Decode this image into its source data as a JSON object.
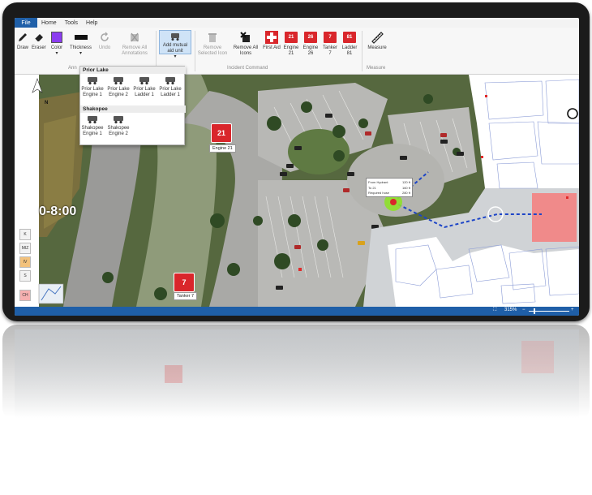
{
  "menu": {
    "file": "File",
    "items": [
      "Home",
      "Tools",
      "Help"
    ]
  },
  "ribbon": {
    "draw": "Draw",
    "eraser": "Eraser",
    "color": "Color",
    "thickness": "Thickness",
    "undo": "Undo",
    "remove_all_annotations": "Remove All Annotations",
    "add_mutual_aid_unit": "Add mutual aid unit",
    "remove_selected_icon": "Remove Selected Icon",
    "remove_all_icons": "Remove All Icons",
    "first_aid": "First Aid",
    "engine21": "Engine 21",
    "engine26": "Engine 26",
    "tanker7": "Tanker 7",
    "ladder81": "Ladder 81",
    "measure": "Measure",
    "group_annotations": "Ann",
    "group_incident_command": "Incident Command",
    "group_measure": "Measure",
    "color_value": "#8b3df0"
  },
  "dropdown": {
    "groups": [
      {
        "name": "Prior Lake",
        "items": [
          "Prior Lake Engine 1",
          "Prior Lake Engine 2",
          "Prior Lake Ladder 1",
          "Prior Lake Ladder 1"
        ]
      },
      {
        "name": "Shakopee",
        "items": [
          "Shakopee Engine 1",
          "Shakopee Engine 2"
        ]
      }
    ]
  },
  "map": {
    "engine21_number": "21",
    "engine21_label": "Engine 21",
    "tanker7_number": "7",
    "tanker7_label": "Tanker 7",
    "time_text": "0-8:00",
    "north": "N",
    "tooltip_rows": [
      {
        "label": "From Hydrant",
        "value": "120 ft"
      },
      {
        "label": "To 21",
        "value": "160 ft"
      },
      {
        "label": "Required hose",
        "value": "280 ft"
      }
    ],
    "left_buttons": [
      "K",
      "MIZ",
      "IV",
      "S",
      "CH"
    ]
  },
  "status": {
    "zoom": "315%"
  },
  "colors": {
    "accent": "#1f5fa8",
    "unit_red": "#d9262b",
    "selection": "#cfe3f7"
  }
}
